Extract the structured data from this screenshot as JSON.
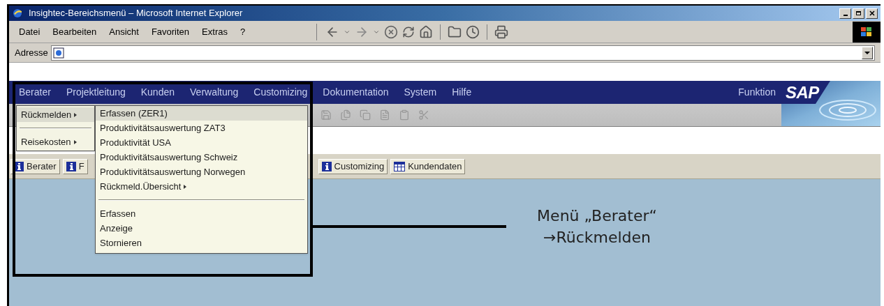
{
  "window": {
    "title": "Insightec-Bereichsmenü – Microsoft Internet Explorer"
  },
  "ie_menu": [
    "Datei",
    "Bearbeiten",
    "Ansicht",
    "Favoriten",
    "Extras",
    "?"
  ],
  "address_bar": {
    "label": "Adresse"
  },
  "sap_menu": {
    "items": [
      "Berater",
      "Projektleitung",
      "Kunden",
      "Verwaltung",
      "Customizing",
      "Dokumentation",
      "System",
      "Hilfe"
    ],
    "function_label": "Funktion",
    "logo": "SAP"
  },
  "berater_menu": [
    {
      "kind": "item",
      "label": "Rückmelden",
      "has_submenu": true,
      "selected": true
    },
    {
      "kind": "separator"
    },
    {
      "kind": "item",
      "label": "Reisekosten",
      "has_submenu": true,
      "selected": false
    }
  ],
  "rueckmelden_menu": [
    {
      "kind": "item",
      "label": "Erfassen (ZER1)",
      "has_submenu": false,
      "selected": true
    },
    {
      "kind": "item",
      "label": "Produktivitätsauswertung ZAT3",
      "has_submenu": false,
      "selected": false
    },
    {
      "kind": "item",
      "label": "Produktivität USA",
      "has_submenu": false,
      "selected": false
    },
    {
      "kind": "item",
      "label": "Produktivitätsauswertung Schweiz",
      "has_submenu": false,
      "selected": false
    },
    {
      "kind": "item",
      "label": "Produktivitätsauswertung Norwegen",
      "has_submenu": false,
      "selected": false
    },
    {
      "kind": "item",
      "label": "Rückmeld.Übersicht",
      "has_submenu": true,
      "selected": false
    },
    {
      "kind": "separator"
    },
    {
      "kind": "item",
      "label": "Erfassen",
      "has_submenu": false,
      "selected": false
    },
    {
      "kind": "item",
      "label": "Anzeige",
      "has_submenu": false,
      "selected": false
    },
    {
      "kind": "item",
      "label": "Stornieren",
      "has_submenu": false,
      "selected": false
    }
  ],
  "button_bar": {
    "left": [
      {
        "label": "Berater",
        "kind": "info"
      },
      {
        "label": "F",
        "kind": "info"
      }
    ],
    "right": [
      {
        "label": "Customizing",
        "kind": "info"
      },
      {
        "label": "Kundendaten",
        "kind": "table"
      }
    ]
  },
  "annotation": {
    "lines": [
      "Menü „Berater“",
      "→Rückmelden"
    ]
  }
}
